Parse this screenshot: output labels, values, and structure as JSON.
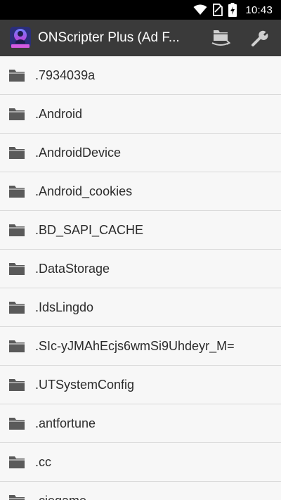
{
  "status_bar": {
    "time": "10:43",
    "battery_level": 1.0,
    "icons": [
      "wifi-icon",
      "no-sim-icon",
      "battery-charging-icon"
    ]
  },
  "app_bar": {
    "title": "ONScripter Plus (Ad F...",
    "actions": [
      {
        "name": "folder-switch-icon"
      },
      {
        "name": "wrench-icon"
      }
    ],
    "colors": {
      "background": "#3a3a3a",
      "text": "#ffffff"
    }
  },
  "file_list": {
    "items": [
      {
        "label": ".7934039a"
      },
      {
        "label": ".Android"
      },
      {
        "label": ".AndroidDevice"
      },
      {
        "label": ".Android_cookies"
      },
      {
        "label": ".BD_SAPI_CACHE"
      },
      {
        "label": ".DataStorage"
      },
      {
        "label": ".IdsLingdo"
      },
      {
        "label": ".SIc-yJMAhEcjs6wmSi9Uhdeyr_M="
      },
      {
        "label": ".UTSystemConfig"
      },
      {
        "label": ".antfortune"
      },
      {
        "label": ".cc"
      },
      {
        "label": ".ciegame"
      }
    ],
    "icon": "folder-icon",
    "colors": {
      "background": "#f7f7f7",
      "divider": "#d9d9d9",
      "text": "#2b2b2b",
      "icon": "#5a5a5a"
    }
  }
}
